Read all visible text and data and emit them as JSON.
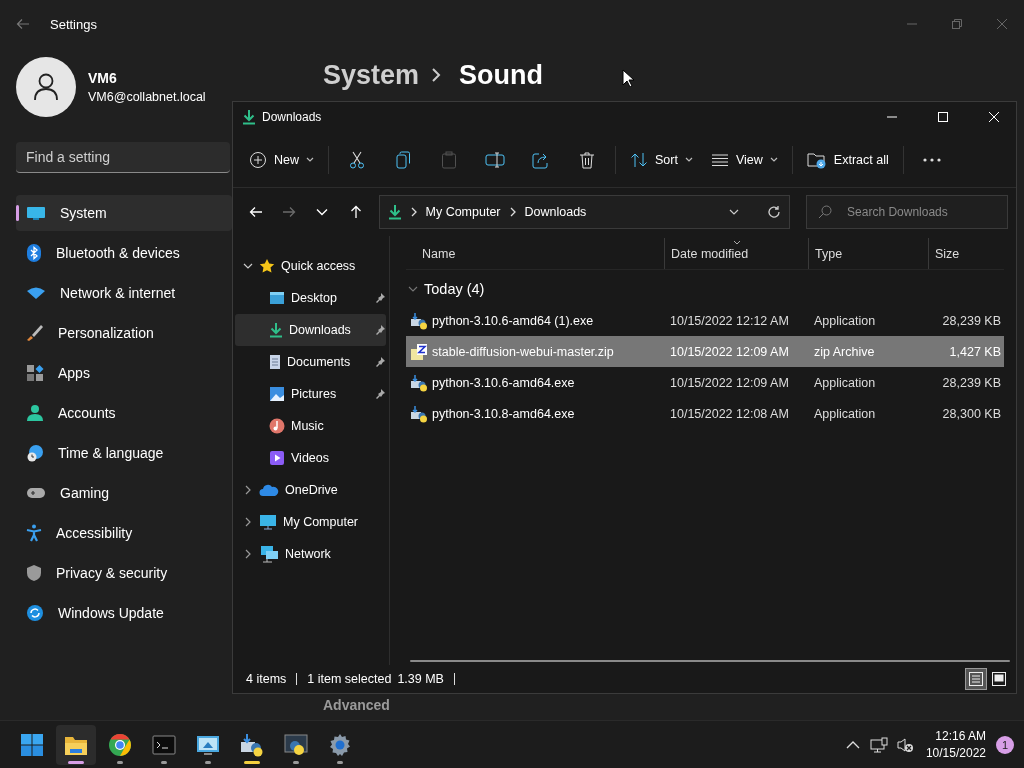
{
  "settings": {
    "title": "Settings",
    "user": {
      "name": "VM6",
      "email": "VM6@collabnet.local"
    },
    "search": {
      "placeholder": "Find a setting"
    },
    "nav_items": [
      {
        "kind": "system",
        "label": "System",
        "selected": true
      },
      {
        "kind": "bluetooth",
        "label": "Bluetooth & devices",
        "selected": false
      },
      {
        "kind": "network",
        "label": "Network & internet",
        "selected": false
      },
      {
        "kind": "brush",
        "label": "Personalization",
        "selected": false
      },
      {
        "kind": "apps",
        "label": "Apps",
        "selected": false
      },
      {
        "kind": "accounts",
        "label": "Accounts",
        "selected": false
      },
      {
        "kind": "time",
        "label": "Time & language",
        "selected": false
      },
      {
        "kind": "gaming",
        "label": "Gaming",
        "selected": false
      },
      {
        "kind": "accessibility",
        "label": "Accessibility",
        "selected": false
      },
      {
        "kind": "privacy",
        "label": "Privacy & security",
        "selected": false
      },
      {
        "kind": "update",
        "label": "Windows Update",
        "selected": false
      }
    ],
    "breadcrumb": {
      "parent": "System",
      "current": "Sound"
    },
    "section_heading": "Advanced"
  },
  "explorer": {
    "title": "Downloads",
    "toolbar": [
      {
        "kind": "new",
        "label": "New",
        "disabled": false
      },
      {
        "kind": "cut",
        "disabled": false
      },
      {
        "kind": "copy",
        "disabled": false
      },
      {
        "kind": "paste",
        "disabled": true
      },
      {
        "kind": "rename",
        "disabled": false
      },
      {
        "kind": "share",
        "disabled": false
      },
      {
        "kind": "delete",
        "disabled": false
      },
      {
        "kind": "sort",
        "label": "Sort",
        "disabled": false
      },
      {
        "kind": "view",
        "label": "View",
        "disabled": false
      },
      {
        "kind": "extract",
        "label": "Extract all",
        "disabled": false
      },
      {
        "kind": "more",
        "disabled": false
      }
    ],
    "nav_buttons": [
      {
        "kind": "back",
        "disabled": false
      },
      {
        "kind": "forward",
        "disabled": true
      },
      {
        "kind": "recent",
        "disabled": false
      },
      {
        "kind": "up",
        "disabled": false
      }
    ],
    "address": {
      "path": [
        "My Computer",
        "Downloads"
      ]
    },
    "search": {
      "placeholder": "Search Downloads"
    },
    "nav_tree": [
      {
        "kind": "star",
        "label": "Quick access",
        "expanded": true,
        "selected": false,
        "children": [
          {
            "kind": "desktop",
            "label": "Desktop",
            "pinned": true,
            "selected": false
          },
          {
            "kind": "downloads",
            "label": "Downloads",
            "pinned": true,
            "selected": true
          },
          {
            "kind": "documents",
            "label": "Documents",
            "pinned": true,
            "selected": false
          },
          {
            "kind": "pictures",
            "label": "Pictures",
            "pinned": true,
            "selected": false
          },
          {
            "kind": "music",
            "label": "Music",
            "pinned": false,
            "selected": false
          },
          {
            "kind": "videos",
            "label": "Videos",
            "pinned": false,
            "selected": false
          }
        ]
      },
      {
        "kind": "cloud",
        "label": "OneDrive",
        "expanded": false,
        "selected": false
      },
      {
        "kind": "computer",
        "label": "My Computer",
        "expanded": false,
        "selected": false
      },
      {
        "kind": "network",
        "label": "Network",
        "expanded": false,
        "selected": false
      }
    ],
    "columns": [
      {
        "label": "Name",
        "sorted": false
      },
      {
        "label": "Date modified",
        "sorted": true
      },
      {
        "label": "Type",
        "sorted": false
      },
      {
        "label": "Size",
        "sorted": false
      }
    ],
    "groups": [
      {
        "label": "Today (4)",
        "expanded": true,
        "rows": [
          {
            "kind": "installer",
            "name": "python-3.10.6-amd64 (1).exe",
            "date": "10/15/2022 12:12 AM",
            "type": "Application",
            "size": "28,239 KB",
            "selected": false
          },
          {
            "kind": "zip",
            "name": "stable-diffusion-webui-master.zip",
            "date": "10/15/2022 12:09 AM",
            "type": "zip Archive",
            "size": "1,427 KB",
            "selected": true
          },
          {
            "kind": "installer",
            "name": "python-3.10.6-amd64.exe",
            "date": "10/15/2022 12:09 AM",
            "type": "Application",
            "size": "28,239 KB",
            "selected": false
          },
          {
            "kind": "installer",
            "name": "python-3.10.8-amd64.exe",
            "date": "10/15/2022 12:08 AM",
            "type": "Application",
            "size": "28,300 KB",
            "selected": false
          }
        ]
      }
    ],
    "status": {
      "count": "4 items",
      "selection": "1 item selected",
      "size": "1.39 MB"
    },
    "views": [
      {
        "kind": "details",
        "selected": true
      },
      {
        "kind": "tiles",
        "selected": false
      }
    ]
  },
  "taskbar": {
    "apps": [
      {
        "kind": "start",
        "running": false,
        "active": false,
        "flashing": false
      },
      {
        "kind": "explorer",
        "running": true,
        "active": true,
        "flashing": false
      },
      {
        "kind": "chrome",
        "running": true,
        "active": false,
        "flashing": false
      },
      {
        "kind": "terminal",
        "running": true,
        "active": false,
        "flashing": false
      },
      {
        "kind": "remote",
        "running": true,
        "active": false,
        "flashing": false
      },
      {
        "kind": "installer",
        "running": true,
        "active": false,
        "flashing": true
      },
      {
        "kind": "python",
        "running": true,
        "active": false,
        "flashing": false
      },
      {
        "kind": "settings",
        "running": true,
        "active": false,
        "flashing": false
      }
    ],
    "clock": {
      "time": "12:16 AM",
      "date": "10/15/2022"
    },
    "notifications": "1"
  }
}
